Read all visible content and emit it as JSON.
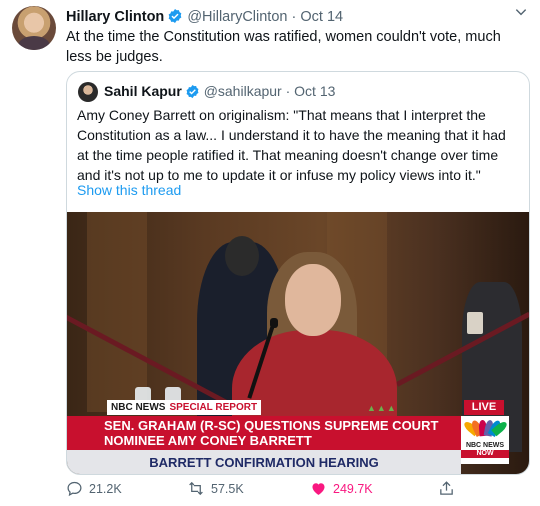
{
  "tweet": {
    "author_name": "Hillary Clinton",
    "handle": "@HillaryClinton",
    "separator": "·",
    "date": "Oct 14",
    "text": "At the time the Constitution was ratified, women couldn't vote, much less be judges."
  },
  "quoted": {
    "author_name": "Sahil Kapur",
    "handle": "@sahilkapur",
    "separator": "·",
    "date": "Oct 13",
    "text": "Amy Coney Barrett on originalism: \"That means that I interpret the Constitution as a law... I understand it to have the meaning that it had at the time people ratified it. That meaning doesn't change over time and it's not up to me to update it or infuse my policy views into it.\"",
    "show_thread": "Show this thread",
    "media": {
      "network": "NBC NEWS",
      "special_report": "SPECIAL REPORT",
      "live": "LIVE",
      "headline_line1": "SEN. GRAHAM (R-SC) QUESTIONS SUPREME COURT",
      "headline_line2": "NOMINEE AMY CONEY BARRETT",
      "subheadline": "BARRETT CONFIRMATION HEARING",
      "logo_line1": "NBC NEWS",
      "logo_line2": "NOW"
    }
  },
  "actions": {
    "replies": "21.2K",
    "retweets": "57.5K",
    "likes": "249.7K"
  },
  "colors": {
    "link": "#1d9bf0",
    "like": "#f91880",
    "verified": "#1d9bf0",
    "banner_red": "#c8102e"
  },
  "icons": [
    "verified-badge-icon",
    "chevron-down-icon",
    "reply-icon",
    "retweet-icon",
    "like-heart-icon",
    "share-icon"
  ]
}
